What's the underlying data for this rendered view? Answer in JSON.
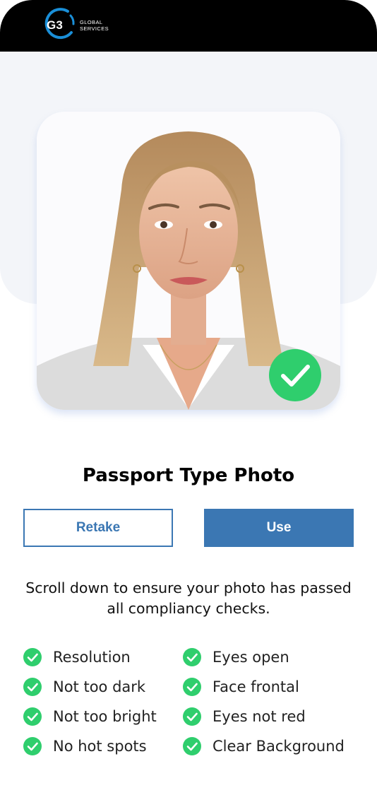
{
  "header": {
    "logo_mark": "G3",
    "logo_line1": "GLOBAL",
    "logo_line2": "SERVICES"
  },
  "photo": {
    "status_icon": "check-icon",
    "status": "approved"
  },
  "title": "Passport Type Photo",
  "buttons": {
    "retake_label": "Retake",
    "use_label": "Use"
  },
  "instructions": "Scroll down to ensure your photo has passed all compliancy checks.",
  "checks": [
    {
      "label": "Resolution",
      "passed": true
    },
    {
      "label": "Eyes open",
      "passed": true
    },
    {
      "label": "Not too dark",
      "passed": true
    },
    {
      "label": "Face frontal",
      "passed": true
    },
    {
      "label": "Not too bright",
      "passed": true
    },
    {
      "label": "Eyes not red",
      "passed": true
    },
    {
      "label": "No hot spots",
      "passed": true
    },
    {
      "label": "Clear Background",
      "passed": true
    }
  ],
  "colors": {
    "primary": "#3b77b3",
    "success": "#2fce6d",
    "header_bg": "#000000",
    "panel_bg": "#f3f5f9",
    "logo_arc": "#1a8fd8"
  }
}
